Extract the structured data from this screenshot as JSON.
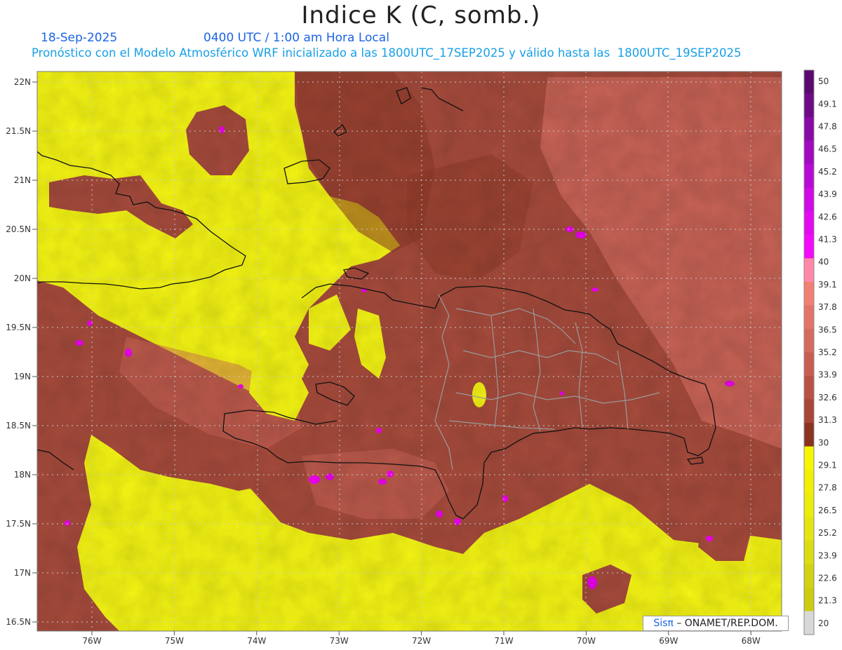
{
  "title": "Indice K (C, somb.)",
  "date": "18-Sep-2025",
  "time_label": "0400 UTC / 1:00 am Hora Local",
  "subtitle": "Pronóstico con el Modelo Atmosférico WRF inicializado a las 1800UTC_17SEP2025 y válido hasta las  1800UTC_19SEP2025",
  "credit": {
    "brand": "Sisπ",
    "org": "– ONAMET/REP.DOM."
  },
  "axes": {
    "lat_labels": [
      "22N",
      "21.5N",
      "21N",
      "20.5N",
      "20N",
      "19.5N",
      "19N",
      "18.5N",
      "18N",
      "17.5N",
      "17N",
      "16.5N"
    ],
    "lon_labels": [
      "76W",
      "75W",
      "74W",
      "73W",
      "72W",
      "71W",
      "70W",
      "69W",
      "68W"
    ]
  },
  "colorbar": {
    "labels": [
      "50",
      "49.1",
      "47.8",
      "46.5",
      "45.2",
      "43.9",
      "42.6",
      "41.3",
      "40",
      "39.1",
      "37.8",
      "36.5",
      "35.2",
      "33.9",
      "32.6",
      "31.3",
      "30",
      "29.1",
      "27.8",
      "26.5",
      "25.2",
      "23.9",
      "22.6",
      "21.3",
      "20"
    ],
    "colors": [
      "#5a0a6e",
      "#6e0a88",
      "#8a0aa5",
      "#a00ac0",
      "#b80ad6",
      "#d00ae6",
      "#e40af0",
      "#f40afa",
      "#ff88aa",
      "#f27f72",
      "#e4736a",
      "#d76a5e",
      "#c85e50",
      "#b85146",
      "#a8463a",
      "#8a3420",
      "#f6f600",
      "#f0f004",
      "#ecec0a",
      "#e4e410",
      "#dcdc12",
      "#d2d212",
      "#cccc0e",
      "#d8d8d8"
    ]
  },
  "map": {
    "colors": {
      "high": "#a64b3c",
      "highest": "#d26a5e",
      "low": "#f5f514",
      "mid": "#8e3a26",
      "magenta": "#f000f0"
    }
  }
}
